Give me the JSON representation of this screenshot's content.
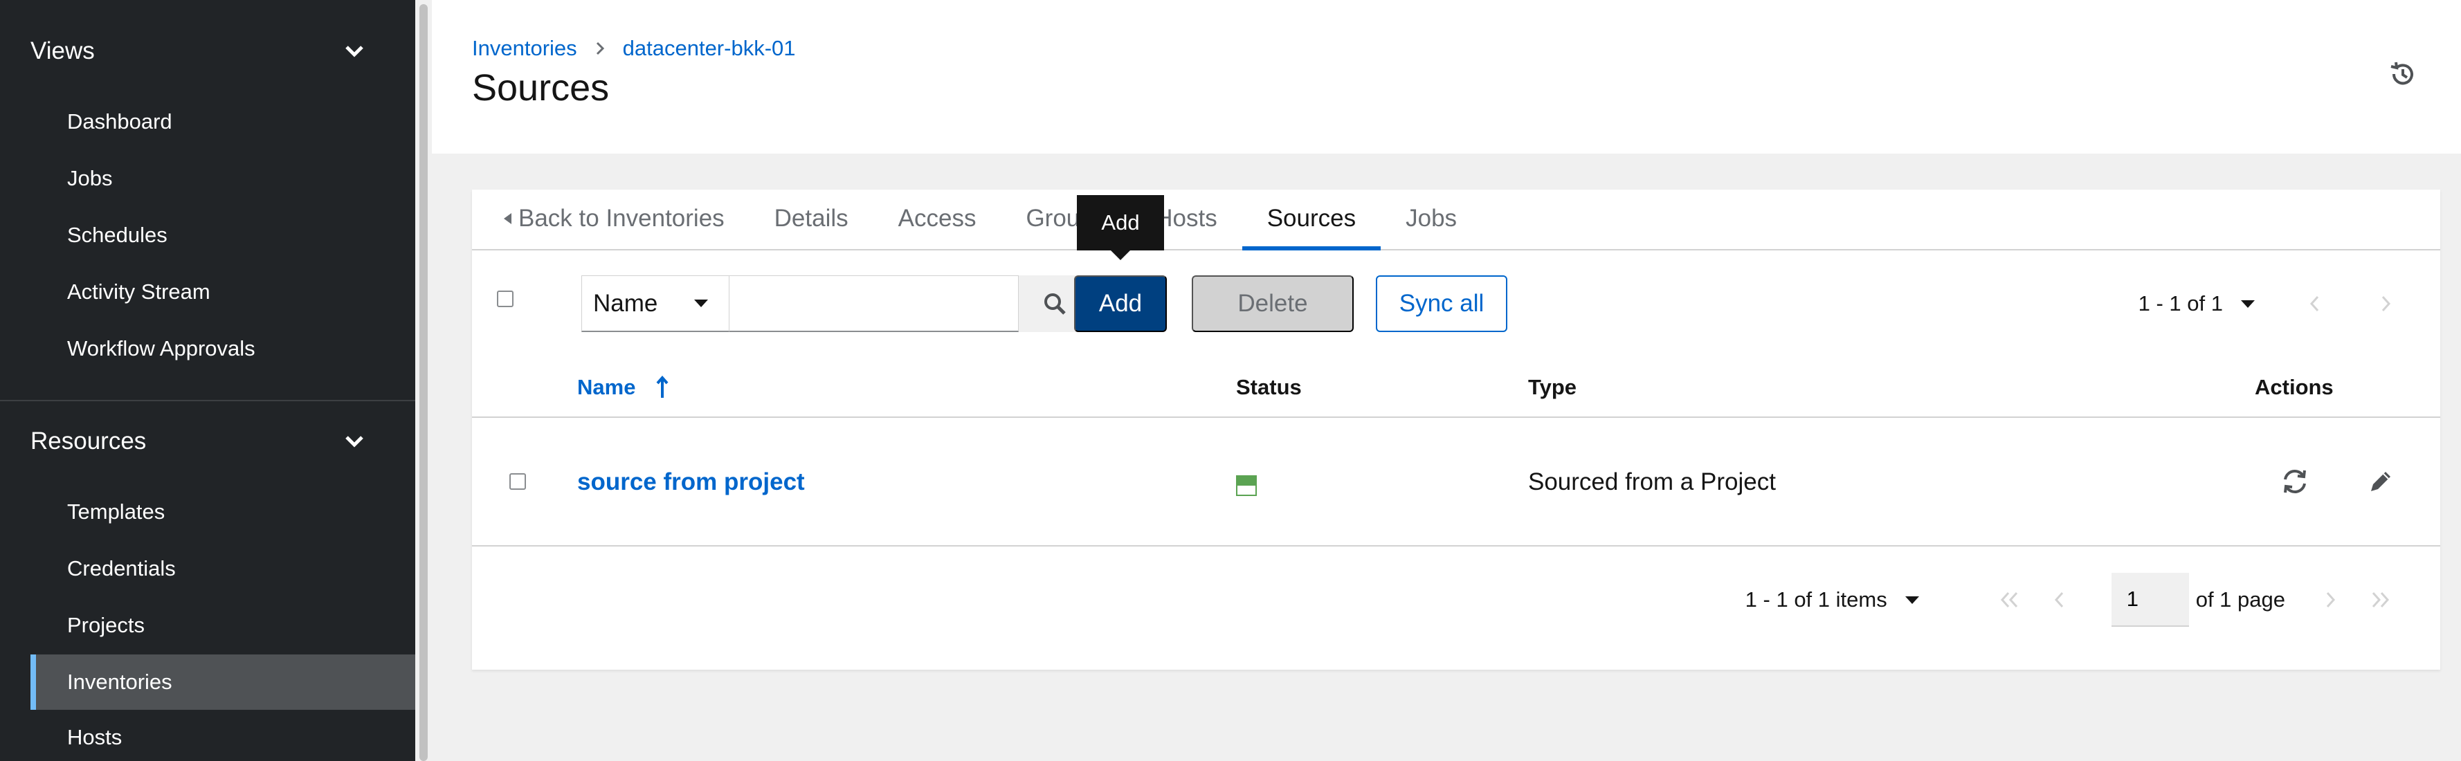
{
  "sidebar": {
    "groups": [
      {
        "label": "Views",
        "items": [
          "Dashboard",
          "Jobs",
          "Schedules",
          "Activity Stream",
          "Workflow Approvals"
        ]
      },
      {
        "label": "Resources",
        "items": [
          "Templates",
          "Credentials",
          "Projects",
          "Inventories",
          "Hosts"
        ]
      }
    ],
    "active_item": "Inventories"
  },
  "breadcrumb": [
    "Inventories",
    "datacenter-bkk-01"
  ],
  "page_title": "Sources",
  "tabs": {
    "back": "Back to Inventories",
    "details": "Details",
    "access": "Access",
    "groups": "Groups",
    "hosts": "Hosts",
    "sources": "Sources",
    "jobs": "Jobs",
    "active": "Sources"
  },
  "toolbar": {
    "filter_field": "Name",
    "search_value": "",
    "add_label": "Add",
    "delete_label": "Delete",
    "sync_label": "Sync all",
    "tooltip": "Add",
    "range": "1 - 1 of 1"
  },
  "table": {
    "columns": {
      "name": "Name",
      "status": "Status",
      "type": "Type",
      "actions": "Actions"
    },
    "sort": "ascending",
    "rows": [
      {
        "name": "source from project",
        "status": "pending",
        "type": "Sourced from a Project"
      }
    ]
  },
  "pagination": {
    "items": "1 - 1 of 1 items",
    "page": "1",
    "of_pages": "of 1 page"
  },
  "colors": {
    "sidebar_bg": "#212427",
    "link": "#0066cc",
    "primary_button": "#004080",
    "active_indicator": "#73bcf7",
    "status_green": "#5ba352"
  }
}
